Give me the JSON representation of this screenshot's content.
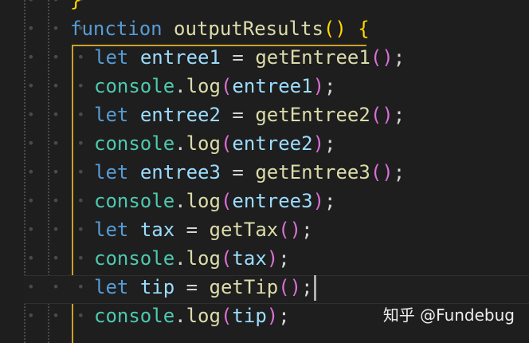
{
  "editor": {
    "lines": [
      {
        "tokens": [
          {
            "t": "}",
            "c": "brace"
          }
        ]
      },
      {
        "tokens": [
          {
            "t": "function",
            "c": "kw"
          },
          {
            "t": " ",
            "c": "op"
          },
          {
            "t": "outputResults",
            "c": "fn"
          },
          {
            "t": "()",
            "c": "brace"
          },
          {
            "t": " ",
            "c": "op"
          },
          {
            "t": "{",
            "c": "brace"
          }
        ]
      },
      {
        "tokens": [
          {
            "t": "let",
            "c": "kw"
          },
          {
            "t": " ",
            "c": "op"
          },
          {
            "t": "entree1",
            "c": "var"
          },
          {
            "t": " = ",
            "c": "op"
          },
          {
            "t": "getEntree1",
            "c": "fn"
          },
          {
            "t": "()",
            "c": "paren"
          },
          {
            "t": ";",
            "c": "punct"
          }
        ]
      },
      {
        "tokens": [
          {
            "t": "console",
            "c": "obj"
          },
          {
            "t": ".",
            "c": "punct"
          },
          {
            "t": "log",
            "c": "fn"
          },
          {
            "t": "(",
            "c": "paren"
          },
          {
            "t": "entree1",
            "c": "var"
          },
          {
            "t": ")",
            "c": "paren"
          },
          {
            "t": ";",
            "c": "punct"
          }
        ]
      },
      {
        "tokens": [
          {
            "t": "let",
            "c": "kw"
          },
          {
            "t": " ",
            "c": "op"
          },
          {
            "t": "entree2",
            "c": "var"
          },
          {
            "t": " = ",
            "c": "op"
          },
          {
            "t": "getEntree2",
            "c": "fn"
          },
          {
            "t": "()",
            "c": "paren"
          },
          {
            "t": ";",
            "c": "punct"
          }
        ]
      },
      {
        "tokens": [
          {
            "t": "console",
            "c": "obj"
          },
          {
            "t": ".",
            "c": "punct"
          },
          {
            "t": "log",
            "c": "fn"
          },
          {
            "t": "(",
            "c": "paren"
          },
          {
            "t": "entree2",
            "c": "var"
          },
          {
            "t": ")",
            "c": "paren"
          },
          {
            "t": ";",
            "c": "punct"
          }
        ]
      },
      {
        "tokens": [
          {
            "t": "let",
            "c": "kw"
          },
          {
            "t": " ",
            "c": "op"
          },
          {
            "t": "entree3",
            "c": "var"
          },
          {
            "t": " = ",
            "c": "op"
          },
          {
            "t": "getEntree3",
            "c": "fn"
          },
          {
            "t": "()",
            "c": "paren"
          },
          {
            "t": ";",
            "c": "punct"
          }
        ]
      },
      {
        "tokens": [
          {
            "t": "console",
            "c": "obj"
          },
          {
            "t": ".",
            "c": "punct"
          },
          {
            "t": "log",
            "c": "fn"
          },
          {
            "t": "(",
            "c": "paren"
          },
          {
            "t": "entree3",
            "c": "var"
          },
          {
            "t": ")",
            "c": "paren"
          },
          {
            "t": ";",
            "c": "punct"
          }
        ]
      },
      {
        "tokens": [
          {
            "t": "let",
            "c": "kw"
          },
          {
            "t": " ",
            "c": "op"
          },
          {
            "t": "tax",
            "c": "var"
          },
          {
            "t": " = ",
            "c": "op"
          },
          {
            "t": "getTax",
            "c": "fn"
          },
          {
            "t": "()",
            "c": "paren"
          },
          {
            "t": ";",
            "c": "punct"
          }
        ]
      },
      {
        "tokens": [
          {
            "t": "console",
            "c": "obj"
          },
          {
            "t": ".",
            "c": "punct"
          },
          {
            "t": "log",
            "c": "fn"
          },
          {
            "t": "(",
            "c": "paren"
          },
          {
            "t": "tax",
            "c": "var"
          },
          {
            "t": ")",
            "c": "paren"
          },
          {
            "t": ";",
            "c": "punct"
          }
        ]
      },
      {
        "tokens": [
          {
            "t": "let",
            "c": "kw"
          },
          {
            "t": " ",
            "c": "op"
          },
          {
            "t": "tip",
            "c": "var"
          },
          {
            "t": " = ",
            "c": "op"
          },
          {
            "t": "getTip",
            "c": "fn"
          },
          {
            "t": "()",
            "c": "paren"
          },
          {
            "t": ";",
            "c": "punct"
          }
        ],
        "cursor": true
      },
      {
        "tokens": [
          {
            "t": "console",
            "c": "obj"
          },
          {
            "t": ".",
            "c": "punct"
          },
          {
            "t": "log",
            "c": "fn"
          },
          {
            "t": "(",
            "c": "paren"
          },
          {
            "t": "tip",
            "c": "var"
          },
          {
            "t": ")",
            "c": "paren"
          },
          {
            "t": ";",
            "c": "punct"
          }
        ]
      }
    ],
    "whitespace_marker": "• • •",
    "colors": {
      "background": "#1e1e1e",
      "keyword": "#569cd6",
      "function": "#dcdcaa",
      "variable": "#9cdcfe",
      "object": "#4ec9b0",
      "bracket_gold": "#ffd700",
      "bracket_purple": "#da70d6",
      "active_guide": "#c9a227"
    }
  },
  "watermark": {
    "text": "知乎 @Fundebug"
  }
}
